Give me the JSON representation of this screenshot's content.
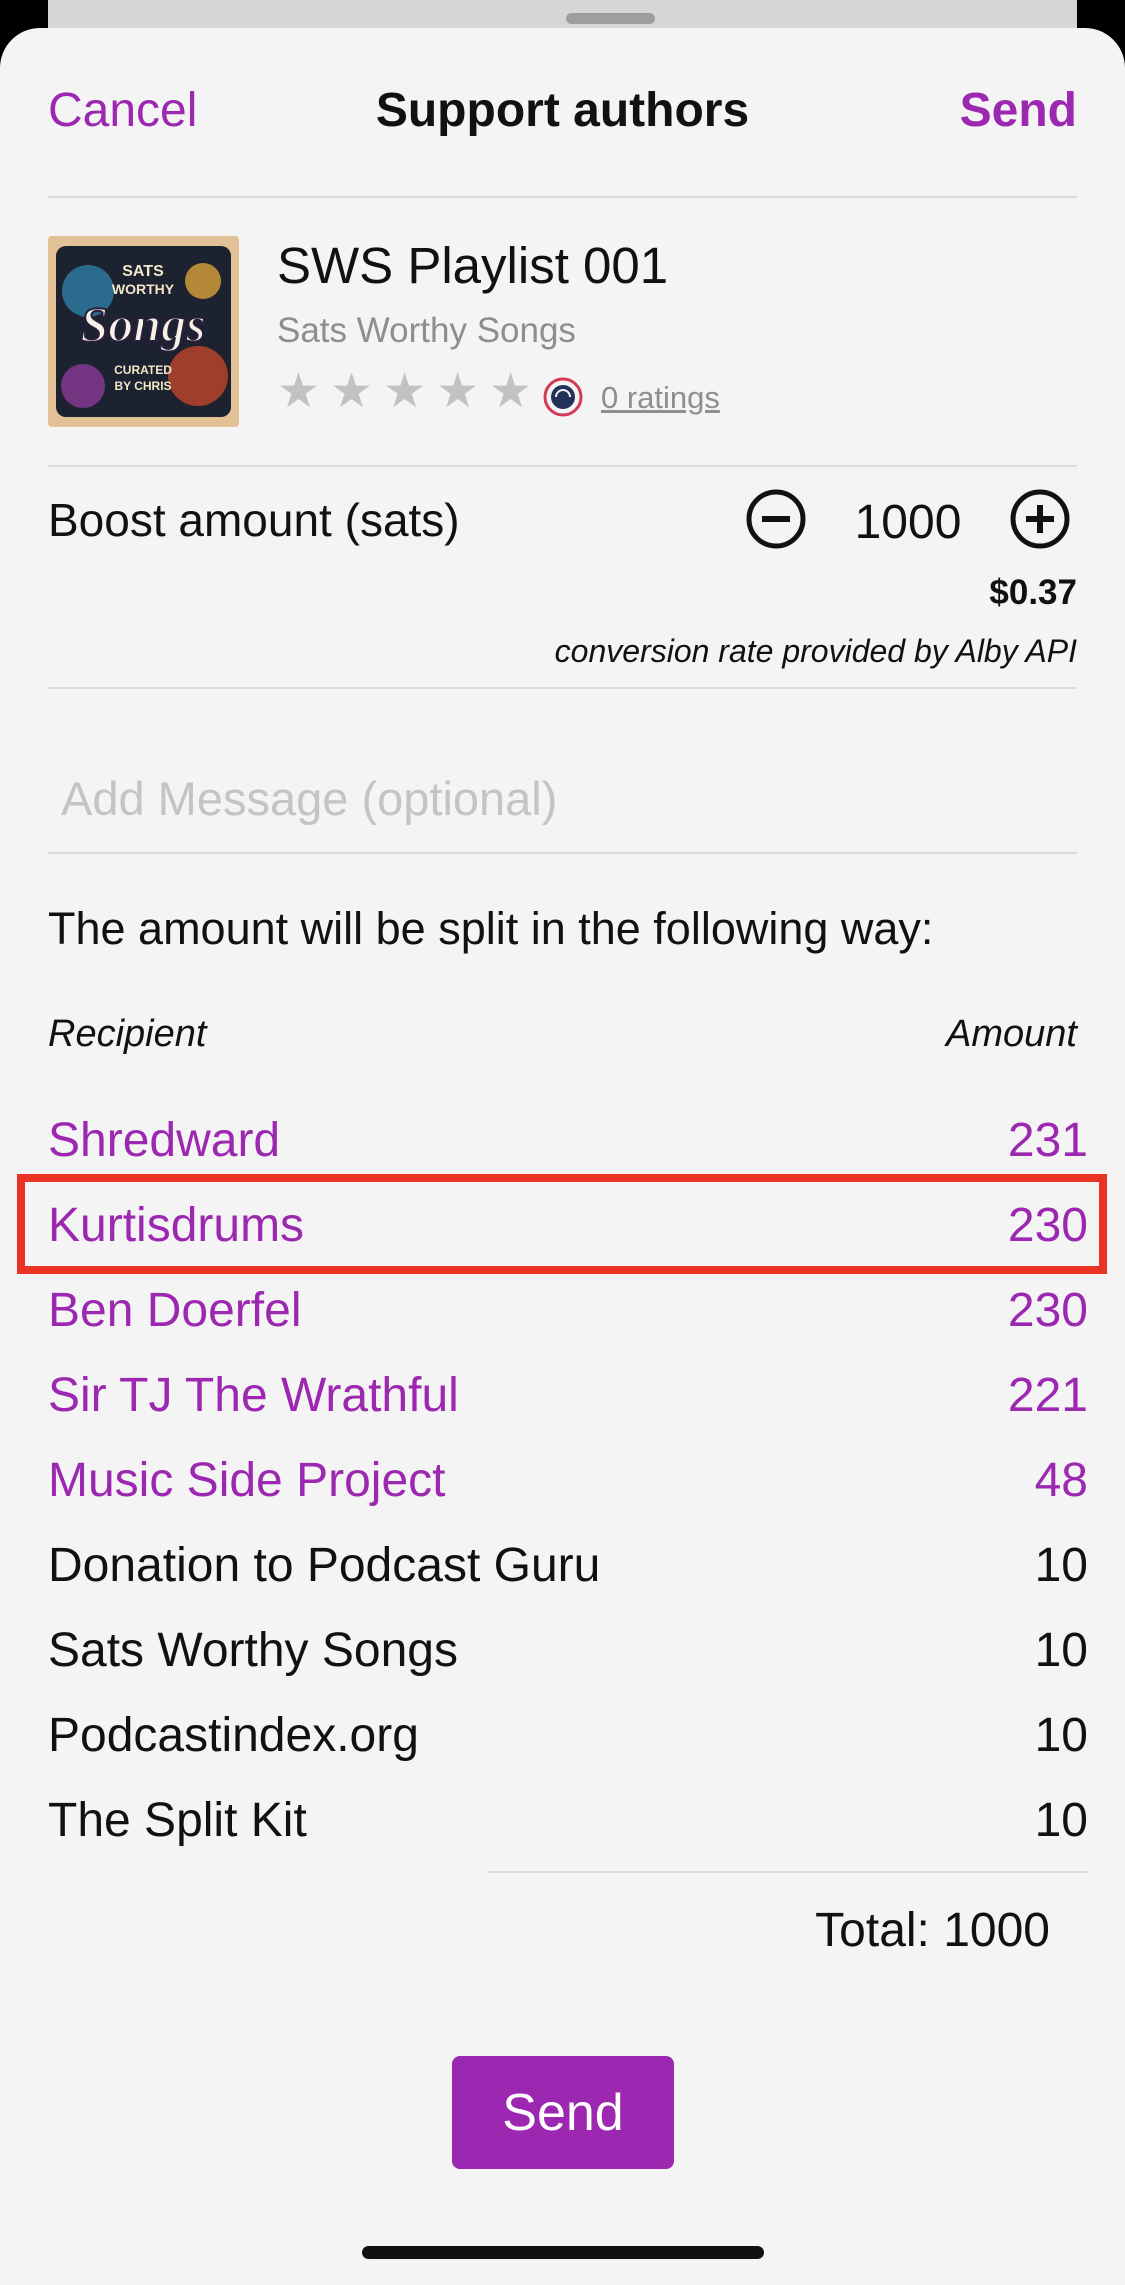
{
  "nav": {
    "cancel_label": "Cancel",
    "title": "Support authors",
    "send_label": "Send"
  },
  "podcast": {
    "title": "SWS Playlist 001",
    "author": "Sats Worthy Songs",
    "rating_stars": 0,
    "ratings_label": "0 ratings",
    "artwork_text": {
      "line1": "SATS",
      "line2": "WORTHY",
      "line3": "Songs",
      "line4": "CURATED",
      "line5": "BY CHRIS"
    }
  },
  "boost": {
    "label": "Boost amount (sats)",
    "value": "1000",
    "fiat": "$0.37",
    "rate_note": "conversion rate provided by Alby API"
  },
  "message": {
    "placeholder": "Add Message (optional)",
    "value": ""
  },
  "split": {
    "intro": "The amount will be split in the following way:",
    "col_recipient": "Recipient",
    "col_amount": "Amount",
    "rows": [
      {
        "name": "Shredward",
        "amount": "231",
        "link": true
      },
      {
        "name": "Kurtisdrums",
        "amount": "230",
        "link": true,
        "highlighted": true
      },
      {
        "name": "Ben Doerfel",
        "amount": "230",
        "link": true
      },
      {
        "name": "Sir TJ The Wrathful",
        "amount": "221",
        "link": true
      },
      {
        "name": "Music Side Project",
        "amount": "48",
        "link": true
      },
      {
        "name": "Donation to Podcast Guru",
        "amount": "10",
        "link": false
      },
      {
        "name": "Sats Worthy Songs",
        "amount": "10",
        "link": false
      },
      {
        "name": "Podcastindex.org",
        "amount": "10",
        "link": false
      },
      {
        "name": "The Split Kit",
        "amount": "10",
        "link": false
      }
    ],
    "total": "Total: 1000"
  },
  "footer": {
    "send_label": "Send"
  },
  "colors": {
    "accent": "#9c27b0",
    "highlight": "#ea3323"
  }
}
